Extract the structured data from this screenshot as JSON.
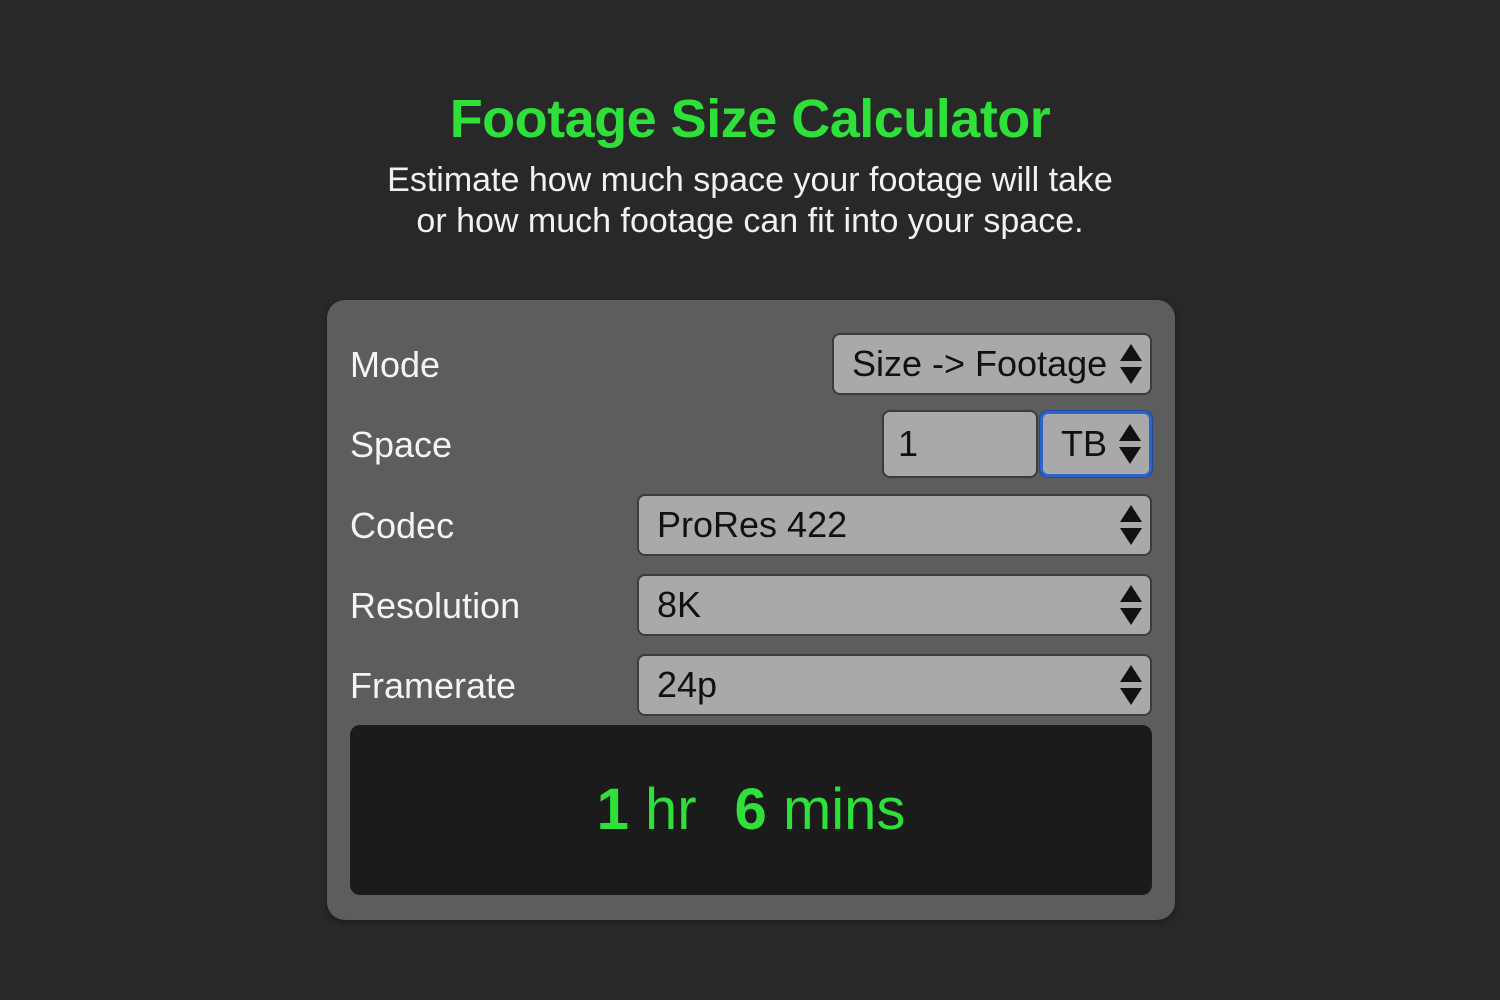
{
  "header": {
    "title": "Footage Size Calculator",
    "subtitle_line1": "Estimate how much space your footage will take",
    "subtitle_line2": "or how much footage can fit into your space."
  },
  "form": {
    "mode": {
      "label": "Mode",
      "value": "Size -> Footage"
    },
    "space": {
      "label": "Space",
      "amount": "1",
      "unit": "TB"
    },
    "codec": {
      "label": "Codec",
      "value": "ProRes 422"
    },
    "resolution": {
      "label": "Resolution",
      "value": "8K"
    },
    "framerate": {
      "label": "Framerate",
      "value": "24p"
    }
  },
  "result": {
    "hours": "1",
    "hours_unit": "hr",
    "minutes": "6",
    "minutes_unit": "mins"
  },
  "colors": {
    "accent": "#2fe03a",
    "background": "#282828",
    "panel": "#5d5d5d",
    "field": "#a9a9a9",
    "focus": "#2e63c9",
    "result_bg": "#1b1b1b"
  },
  "icons": {
    "select_arrows": "updown-arrows-icon"
  }
}
